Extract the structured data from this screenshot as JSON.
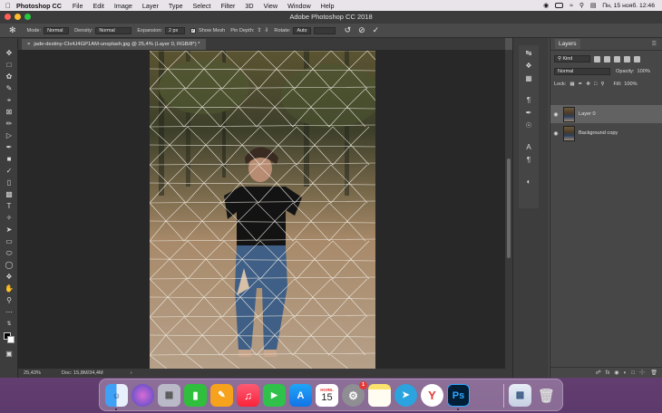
{
  "menubar": {
    "app_name": "Photoshop CC",
    "items": [
      "File",
      "Edit",
      "Image",
      "Layer",
      "Type",
      "Select",
      "Filter",
      "3D",
      "View",
      "Window",
      "Help"
    ],
    "datetime": "Пн, 15 нояб.  12:46"
  },
  "window": {
    "title": "Adobe Photoshop CC 2018"
  },
  "options": {
    "mode_label": "Mode:",
    "mode_value": "Normal",
    "density_label": "Density:",
    "density_value": "Normal",
    "expansion_label": "Expansion:",
    "expansion_value": "2 px",
    "show_mesh_label": "Show Mesh",
    "pin_depth_label": "Pin Depth:",
    "rotate_label": "Rotate:",
    "rotate_value": "Auto"
  },
  "document": {
    "tab_title": "jade-destiny-CIx4J4GP1AM-unsplash.jpg @ 25,4% (Layer 0, RGB/8*) *",
    "close_glyph": "×"
  },
  "status": {
    "zoom": "25,43%",
    "doc": "Doc: 15,8M/34,4M",
    "arrow": "›"
  },
  "layers_panel": {
    "tab_label": "Layers",
    "kind_label": "Kind",
    "blend_mode": "Normal",
    "opacity_label": "Opacity:",
    "opacity_value": "100%",
    "lock_label": "Lock:",
    "fill_label": "Fill:",
    "fill_value": "100%",
    "layers": [
      {
        "name": "Layer 0",
        "active": true
      },
      {
        "name": "Background copy",
        "active": false
      }
    ]
  },
  "dock": {
    "calendar_month": "НОЯБ.",
    "calendar_day": "15",
    "settings_badge": "1",
    "icons": [
      "finder-icon",
      "siri-icon",
      "launchpad-icon",
      "numbers-icon",
      "pages-icon",
      "music-icon",
      "facetime-icon",
      "appstore-icon",
      "calendar-icon",
      "system-preferences-icon",
      "notes-icon",
      "telegram-icon",
      "yandex-icon",
      "photoshop-icon",
      "preview-icon",
      "trash-icon"
    ],
    "ps_label": "Ps"
  },
  "colors": {
    "accent": "#31a8ff",
    "panel": "#474747",
    "canvas_bg": "#282828"
  }
}
